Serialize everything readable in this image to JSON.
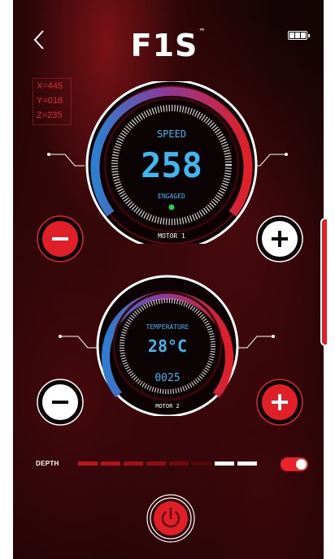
{
  "app": {
    "logo": "F1S",
    "logo_mark": "™"
  },
  "nav": {
    "back_icon": "chevron-left-icon",
    "battery_icon": "battery-full-icon"
  },
  "coordinates": {
    "x": "X=445",
    "y": "Y=018",
    "z": "Z=235"
  },
  "motor1": {
    "label": "SPEED",
    "value": "258",
    "status": "ENGAGED",
    "name": "MOTOR 1",
    "status_color": "#2bd04a"
  },
  "motor2": {
    "label": "TEMPERATURE",
    "value": "28°C",
    "sub_value": "0025",
    "name": "MOTOR 2"
  },
  "depth": {
    "label": "DEPTH",
    "segments": [
      "#c0141e",
      "#b01219",
      "#a01016",
      "#8e0e13",
      "#6e0a0e",
      "#560809",
      "#ffffff",
      "#ffffff"
    ]
  },
  "colors": {
    "accent_red": "#e11f28",
    "digit_blue": "#3fb8f2",
    "ring_blue": "#2c7fd0"
  }
}
